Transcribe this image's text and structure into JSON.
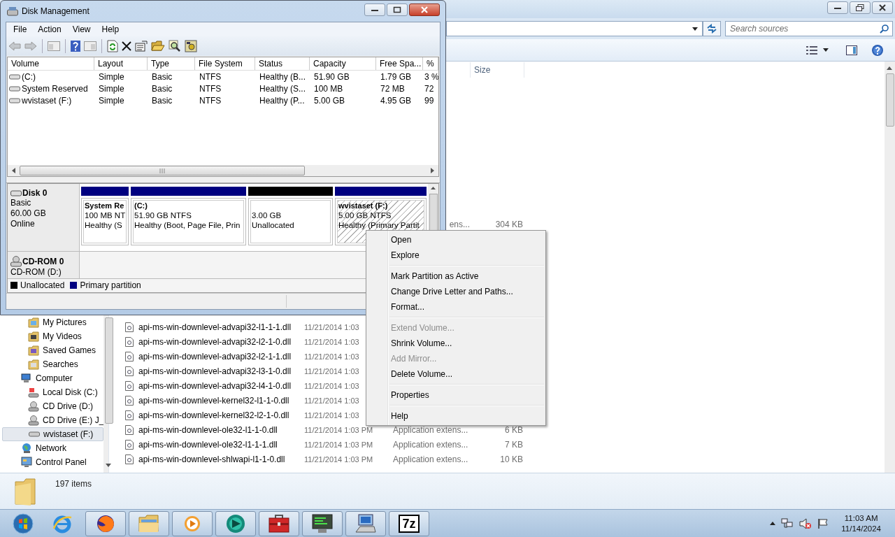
{
  "explorer": {
    "search": {
      "placeholder": "Search sources"
    },
    "columns": [
      {
        "label": "Size"
      }
    ],
    "nav": [
      {
        "children": [
          {
            "label": "My Pictures",
            "kind": "pictures",
            "selected": false
          },
          {
            "label": "My Videos",
            "kind": "videos",
            "selected": false
          },
          {
            "label": "Saved Games",
            "kind": "games",
            "selected": false
          },
          {
            "label": "Searches",
            "kind": "searches",
            "selected": false
          }
        ]
      },
      {
        "label": "Computer",
        "kind": "computer",
        "selected": false,
        "children": [
          {
            "label": "Local Disk (C:)",
            "kind": "disk",
            "selected": false
          },
          {
            "label": "CD Drive (D:)",
            "kind": "cd",
            "selected": false
          },
          {
            "label": "CD Drive (E:) J_",
            "kind": "cd",
            "selected": false
          },
          {
            "label": "wvistaset (F:)",
            "kind": "drive",
            "selected": true
          }
        ]
      },
      {
        "label": "Network",
        "kind": "network",
        "selected": false
      },
      {
        "label": "Control Panel",
        "kind": "control",
        "selected": false
      }
    ],
    "partial_row": {
      "type": "ens...",
      "size": "304 KB"
    },
    "files": [
      {
        "name": "api-ms-win-downlevel-advapi32-l1-1-1.dll",
        "date": "11/21/2014 1:03"
      },
      {
        "name": "api-ms-win-downlevel-advapi32-l2-1-0.dll",
        "date": "11/21/2014 1:03"
      },
      {
        "name": "api-ms-win-downlevel-advapi32-l2-1-1.dll",
        "date": "11/21/2014 1:03"
      },
      {
        "name": "api-ms-win-downlevel-advapi32-l3-1-0.dll",
        "date": "11/21/2014 1:03"
      },
      {
        "name": "api-ms-win-downlevel-advapi32-l4-1-0.dll",
        "date": "11/21/2014 1:03"
      },
      {
        "name": "api-ms-win-downlevel-kernel32-l1-1-0.dll",
        "date": "11/21/2014 1:03"
      },
      {
        "name": "api-ms-win-downlevel-kernel32-l2-1-0.dll",
        "date": "11/21/2014 1:03"
      },
      {
        "name": "api-ms-win-downlevel-ole32-l1-1-0.dll",
        "date": "11/21/2014 1:03 PM",
        "type": "Application extens...",
        "size": "6 KB"
      },
      {
        "name": "api-ms-win-downlevel-ole32-l1-1-1.dll",
        "date": "11/21/2014 1:03 PM",
        "type": "Application extens...",
        "size": "7 KB"
      },
      {
        "name": "api-ms-win-downlevel-shlwapi-l1-1-0.dll",
        "date": "11/21/2014 1:03 PM",
        "type": "Application extens...",
        "size": "10 KB"
      }
    ],
    "status": "197 items"
  },
  "disk_management": {
    "title": "Disk Management",
    "menu": [
      "File",
      "Action",
      "View",
      "Help"
    ],
    "columns": [
      "Volume",
      "Layout",
      "Type",
      "File System",
      "Status",
      "Capacity",
      "Free Spa...",
      "%"
    ],
    "volumes": [
      {
        "cells": [
          "(C:)",
          "Simple",
          "Basic",
          "NTFS",
          "Healthy (B...",
          "51.90 GB",
          "1.79 GB",
          "3 %"
        ]
      },
      {
        "cells": [
          "System Reserved",
          "Simple",
          "Basic",
          "NTFS",
          "Healthy (S...",
          "100 MB",
          "72 MB",
          "72"
        ]
      },
      {
        "cells": [
          "wvistaset (F:)",
          "Simple",
          "Basic",
          "NTFS",
          "Healthy (P...",
          "5.00 GB",
          "4.95 GB",
          "99"
        ]
      }
    ],
    "disks": [
      {
        "name": "Disk 0",
        "kind": "disk",
        "lines": [
          "Basic",
          "60.00 GB",
          "Online"
        ],
        "partitions": [
          {
            "title": "System Re",
            "size": "100 MB NT",
            "status": "Healthy (S",
            "kind": "primary",
            "selected": false
          },
          {
            "title": "(C:)",
            "size": "51.90 GB NTFS",
            "status": "Healthy (Boot, Page File, Prin",
            "kind": "primary",
            "selected": false
          },
          {
            "size": "3.00 GB",
            "status": "Unallocated",
            "kind": "unallocated",
            "selected": false
          },
          {
            "title": "wvistaset  (F:)",
            "size": "5.00 GB NTFS",
            "status": "Healthy (Primary Partit",
            "kind": "primary",
            "selected": true
          }
        ]
      },
      {
        "name": "CD-ROM 0",
        "kind": "cdrom",
        "lines": [
          "CD-ROM (D:)"
        ]
      }
    ],
    "legend": [
      {
        "label": "Unallocated",
        "color": "#000000"
      },
      {
        "label": "Primary partition",
        "color": "#000080"
      }
    ]
  },
  "context_menu": [
    {
      "kind": "item",
      "label": "Open",
      "disabled": false
    },
    {
      "kind": "item",
      "label": "Explore",
      "disabled": false
    },
    {
      "kind": "separator"
    },
    {
      "kind": "item",
      "label": "Mark Partition as Active",
      "disabled": false
    },
    {
      "kind": "item",
      "label": "Change Drive Letter and Paths...",
      "disabled": false
    },
    {
      "kind": "item",
      "label": "Format...",
      "disabled": false
    },
    {
      "kind": "separator"
    },
    {
      "kind": "item",
      "label": "Extend Volume...",
      "disabled": true
    },
    {
      "kind": "item",
      "label": "Shrink Volume...",
      "disabled": false
    },
    {
      "kind": "item",
      "label": "Add Mirror...",
      "disabled": true
    },
    {
      "kind": "item",
      "label": "Delete Volume...",
      "disabled": false
    },
    {
      "kind": "separator"
    },
    {
      "kind": "item",
      "label": "Properties",
      "disabled": false
    },
    {
      "kind": "separator"
    },
    {
      "kind": "item",
      "label": "Help",
      "disabled": false
    }
  ],
  "taskbar": {
    "buttons": [
      {
        "kind": "ie",
        "running": false
      },
      {
        "kind": "firefox",
        "running": true
      },
      {
        "kind": "folder",
        "running": true
      },
      {
        "kind": "media",
        "running": true
      },
      {
        "kind": "disc",
        "running": true
      },
      {
        "kind": "toolbox",
        "running": true
      },
      {
        "kind": "monitor",
        "running": true
      },
      {
        "kind": "computer",
        "running": true
      },
      {
        "kind": "archive",
        "label": "7z",
        "running": true
      }
    ],
    "time": "11:03 AM",
    "date": "11/14/2024"
  }
}
